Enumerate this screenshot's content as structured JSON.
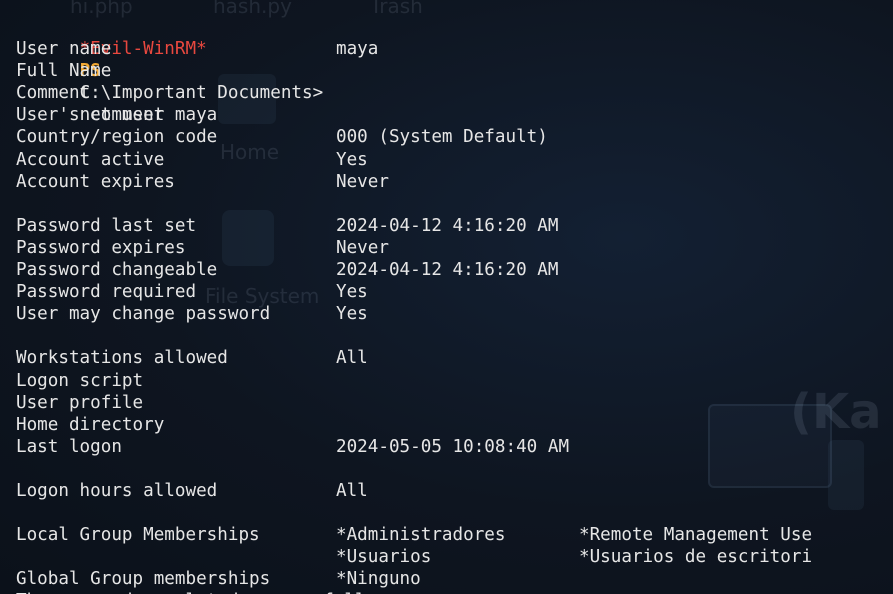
{
  "desktop": {
    "icons": [
      {
        "label": "hi.php"
      },
      {
        "label": "hash.py"
      },
      {
        "label": "Trash"
      },
      {
        "label": "Home"
      },
      {
        "label": "File System"
      }
    ],
    "brand": "(Ka"
  },
  "prompt": {
    "host": "*Evil-WinRM*",
    "shell": "PS",
    "path": "C:\\Important Documents>",
    "command": "net user maya"
  },
  "output": [
    {
      "key": "User name",
      "value": "maya",
      "value2": ""
    },
    {
      "key": "Full Name",
      "value": "",
      "value2": ""
    },
    {
      "key": "Comment",
      "value": "",
      "value2": ""
    },
    {
      "key": "User's comment",
      "value": "",
      "value2": ""
    },
    {
      "key": "Country/region code",
      "value": "000 (System Default)",
      "value2": ""
    },
    {
      "key": "Account active",
      "value": "Yes",
      "value2": ""
    },
    {
      "key": "Account expires",
      "value": "Never",
      "value2": ""
    },
    {
      "key": "",
      "value": "",
      "value2": ""
    },
    {
      "key": "Password last set",
      "value": "2024-04-12 4:16:20 AM",
      "value2": ""
    },
    {
      "key": "Password expires",
      "value": "Never",
      "value2": ""
    },
    {
      "key": "Password changeable",
      "value": "2024-04-12 4:16:20 AM",
      "value2": ""
    },
    {
      "key": "Password required",
      "value": "Yes",
      "value2": ""
    },
    {
      "key": "User may change password",
      "value": "Yes",
      "value2": ""
    },
    {
      "key": "",
      "value": "",
      "value2": ""
    },
    {
      "key": "Workstations allowed",
      "value": "All",
      "value2": ""
    },
    {
      "key": "Logon script",
      "value": "",
      "value2": ""
    },
    {
      "key": "User profile",
      "value": "",
      "value2": ""
    },
    {
      "key": "Home directory",
      "value": "",
      "value2": ""
    },
    {
      "key": "Last logon",
      "value": "2024-05-05 10:08:40 AM",
      "value2": ""
    },
    {
      "key": "",
      "value": "",
      "value2": ""
    },
    {
      "key": "Logon hours allowed",
      "value": "All",
      "value2": ""
    },
    {
      "key": "",
      "value": "",
      "value2": ""
    },
    {
      "key": "Local Group Memberships",
      "value": "*Administradores",
      "value2": "*Remote Management Use"
    },
    {
      "key": "",
      "value": "*Usuarios",
      "value2": "*Usuarios de escritori"
    },
    {
      "key": "Global Group memberships",
      "value": "*Ninguno",
      "value2": ""
    },
    {
      "key": "The command completed successfully.",
      "value": "",
      "value2": ""
    }
  ],
  "colors": {
    "host": "#e8483f",
    "shell": "#f0a732",
    "text": "#e6e6e6",
    "background": "#0f1622"
  }
}
